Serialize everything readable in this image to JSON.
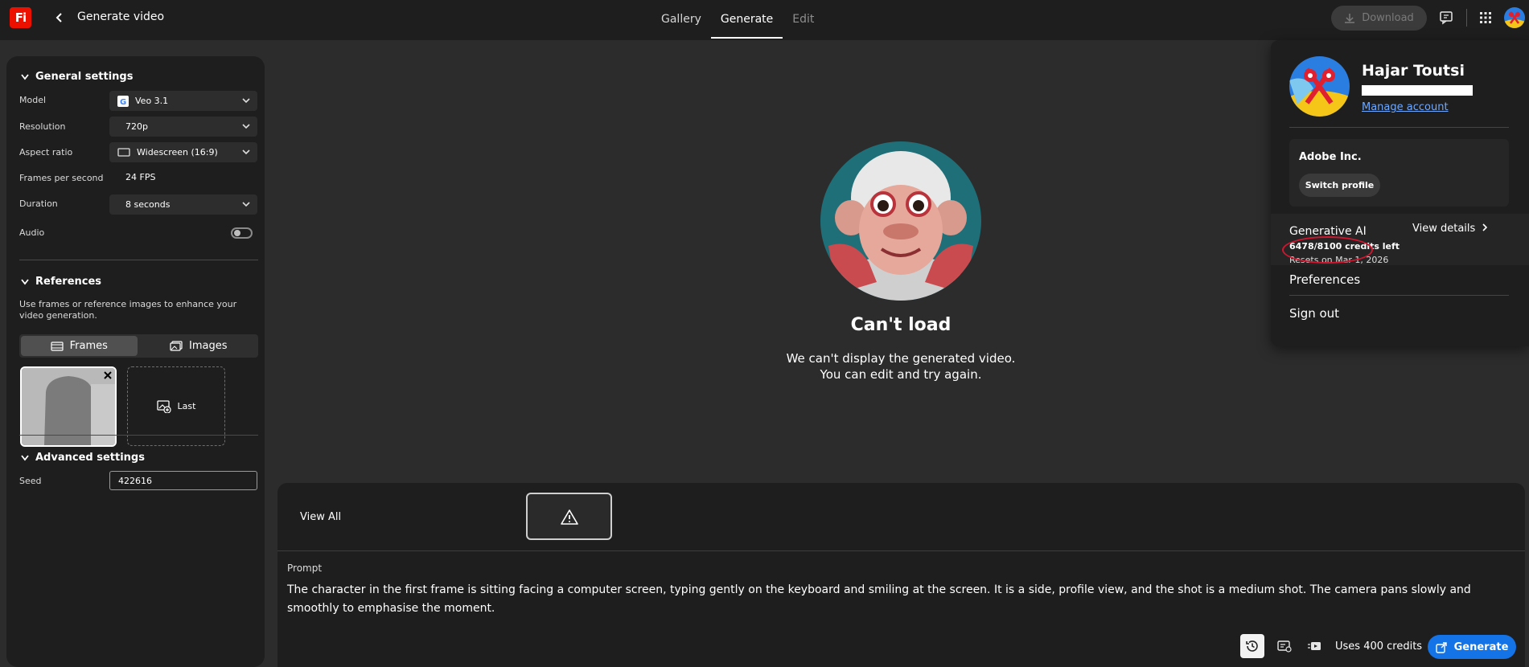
{
  "app": {
    "logo_text": "Fi",
    "page_title": "Generate video"
  },
  "nav": {
    "tabs": [
      "Gallery",
      "Generate",
      "Edit"
    ],
    "active_tab": "Generate"
  },
  "toolbar": {
    "download_label": "Download"
  },
  "general": {
    "heading": "General settings",
    "model_label": "Model",
    "model_value": "Veo 3.1",
    "resolution_label": "Resolution",
    "resolution_value": "720p",
    "aspect_label": "Aspect ratio",
    "aspect_value": "Widescreen (16:9)",
    "fps_label": "Frames per second",
    "fps_value": "24 FPS",
    "duration_label": "Duration",
    "duration_value": "8 seconds",
    "audio_label": "Audio",
    "audio_enabled": false
  },
  "references": {
    "heading": "References",
    "description": "Use frames or reference images to enhance your video generation.",
    "tab_frames": "Frames",
    "tab_images": "Images",
    "last_label": "Last"
  },
  "advanced": {
    "heading": "Advanced settings",
    "seed_label": "Seed",
    "seed_value": "422616"
  },
  "status": {
    "title": "Can't load",
    "line1": "We can't display the generated video.",
    "line2": "You can edit and try again."
  },
  "bottom": {
    "view_all": "View All",
    "prompt_label": "Prompt",
    "prompt_text": "The character in the first frame is sitting facing a computer screen, typing gently on the keyboard and smiling at the screen. It is a side, profile view, and the shot is a medium shot. The camera pans slowly and smoothly to emphasise the moment.",
    "uses_credits": "Uses 400 credits",
    "generate_label": "Generate"
  },
  "profile": {
    "name": "Hajar Toutsi",
    "manage": "Manage account",
    "org": "Adobe Inc.",
    "switch": "Switch profile",
    "gen_ai_title": "Generative AI",
    "view_details": "View details",
    "credits": "6478/8100 credits left",
    "resets": "Resets on Mar 1, 2026",
    "preferences": "Preferences",
    "sign_out": "Sign out"
  },
  "colors": {
    "accent": "#1473e6",
    "brand": "#eb1000",
    "highlight_circle": "#d0162e"
  }
}
